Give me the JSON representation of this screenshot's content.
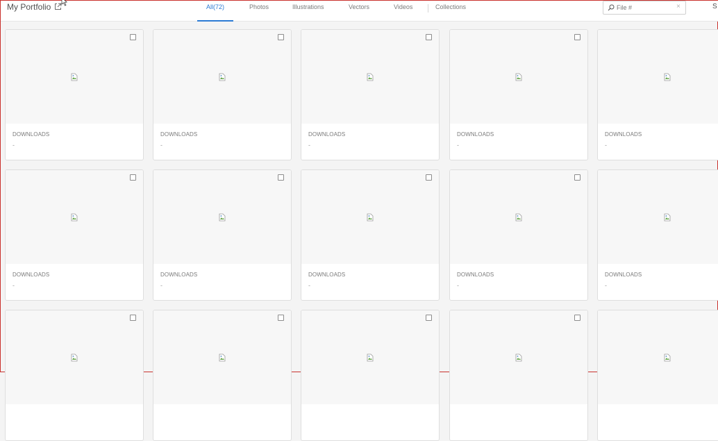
{
  "header": {
    "title": "My Portfolio",
    "open_external_icon": "external-link-icon",
    "tabs": [
      {
        "label": "All(72)",
        "active": true
      },
      {
        "label": "Photos",
        "active": false
      },
      {
        "label": "Illustrations",
        "active": false
      },
      {
        "label": "Vectors",
        "active": false
      },
      {
        "label": "Videos",
        "active": false
      },
      {
        "label": "Collections",
        "active": false
      }
    ],
    "search": {
      "placeholder": "File #",
      "value": "",
      "clear_icon": "×"
    },
    "right_cut_text": "S"
  },
  "colors": {
    "accent": "#2c7bd4",
    "window_border": "#c9302c"
  },
  "cards": [
    {
      "label": "DOWNLOADS",
      "value": "-"
    },
    {
      "label": "DOWNLOADS",
      "value": "-"
    },
    {
      "label": "DOWNLOADS",
      "value": "-"
    },
    {
      "label": "DOWNLOADS",
      "value": "-"
    },
    {
      "label": "DOWNLOADS",
      "value": "-"
    },
    {
      "label": "DOWNLOADS",
      "value": "-"
    },
    {
      "label": "DOWNLOADS",
      "value": "-"
    },
    {
      "label": "DOWNLOADS",
      "value": "-"
    },
    {
      "label": "DOWNLOADS",
      "value": "-"
    },
    {
      "label": "DOWNLOADS",
      "value": "-"
    },
    {
      "label": "",
      "value": ""
    },
    {
      "label": "",
      "value": ""
    },
    {
      "label": "",
      "value": ""
    },
    {
      "label": "",
      "value": ""
    },
    {
      "label": "",
      "value": ""
    }
  ]
}
